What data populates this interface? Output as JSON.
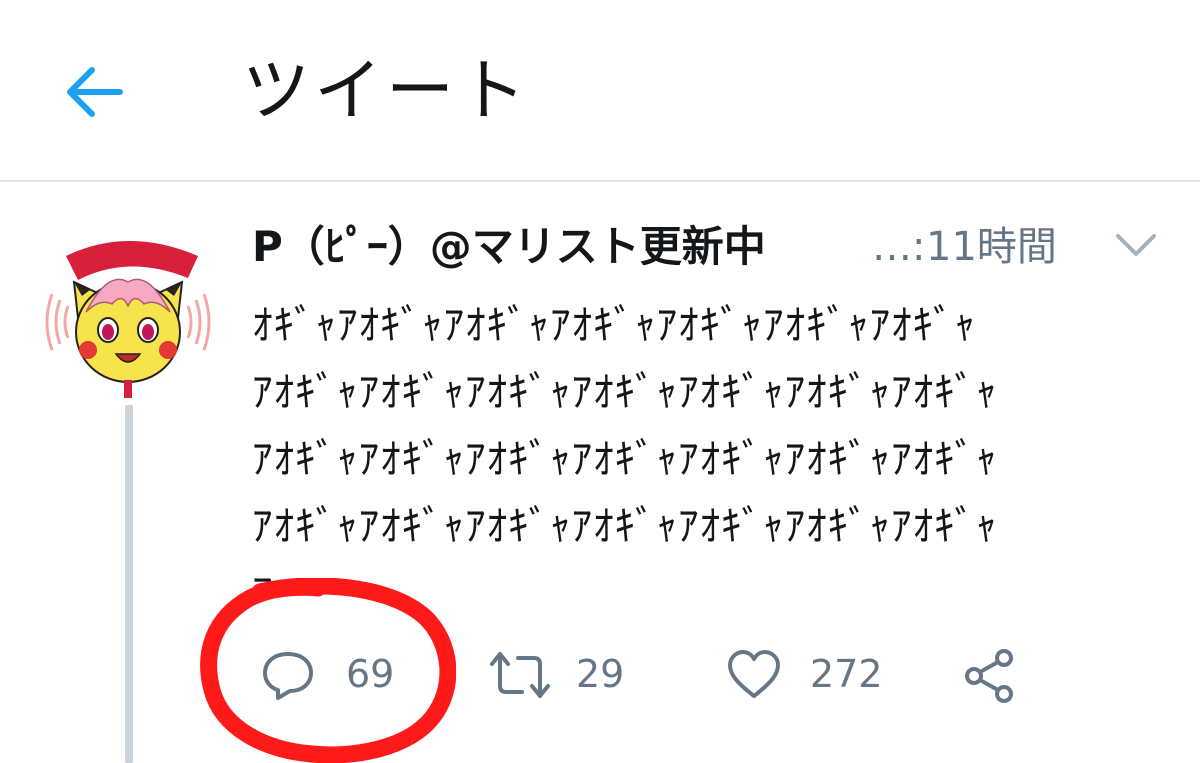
{
  "header": {
    "title": "ツイート",
    "back_icon": "arrow-left-icon"
  },
  "tweet": {
    "display_name": "P（ﾋﾟｰ）@マリスト更新中",
    "ellipsis": "…:",
    "timestamp": "11時間",
    "menu_icon": "chevron-down-icon",
    "text_lines": [
      "ｵｷﾞｬｱｵｷﾞｬｱｵｷﾞｬｱｵｷﾞｬｱｵｷﾞｬｱｵｷﾞｬｱｵｷﾞｬ",
      "ｱｵｷﾞｬｱｵｷﾞｬｱｵｷﾞｬｱｵｷﾞｬｱｵｷﾞｬｱｵｷﾞｬｱｵｷﾞｬ",
      "ｱｵｷﾞｬｱｵｷﾞｬｱｵｷﾞｬｱｵｷﾞｬｱｵｷﾞｬｱｵｷﾞｬｱｵｷﾞｬ",
      "ｱｵｷﾞｬｱｵｷﾞｬｱｵｷﾞｬｱｵｷﾞｬｱｵｷﾞｬｱｵｷﾞｬｱｵｷﾞｬ",
      "ｱ"
    ],
    "actions": {
      "reply": {
        "icon": "reply-bubble-icon",
        "count": "69"
      },
      "retweet": {
        "icon": "retweet-icon",
        "count": "29"
      },
      "like": {
        "icon": "heart-icon",
        "count": "272"
      },
      "share": {
        "icon": "share-icon"
      }
    }
  },
  "colors": {
    "accent": "#1da1f2",
    "secondary_text": "#657786",
    "annotation": "#ff1a1a"
  }
}
